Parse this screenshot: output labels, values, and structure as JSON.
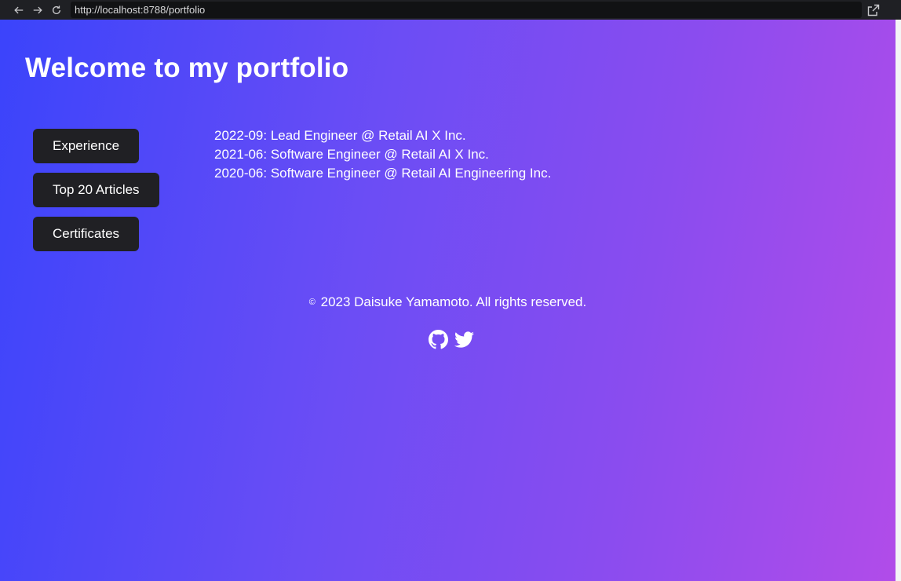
{
  "browser": {
    "url": "http://localhost:8788/portfolio"
  },
  "page": {
    "title": "Welcome to my portfolio",
    "menu": [
      "Experience",
      "Top 20 Articles",
      "Certificates"
    ],
    "experience": [
      "2022-09: Lead Engineer @ Retail AI X Inc.",
      "2021-06: Software Engineer @ Retail AI X Inc.",
      "2020-06: Software Engineer @ Retail AI Engineering Inc."
    ],
    "footer": {
      "copyright_symbol": "©",
      "copyright_text": "2023 Daisuke Yamamoto. All rights reserved."
    },
    "socials": [
      "github-icon",
      "twitter-icon"
    ]
  },
  "colors": {
    "gradient_start": "#3b44fb",
    "gradient_end": "#b14ce9",
    "button_bg": "#202024"
  }
}
